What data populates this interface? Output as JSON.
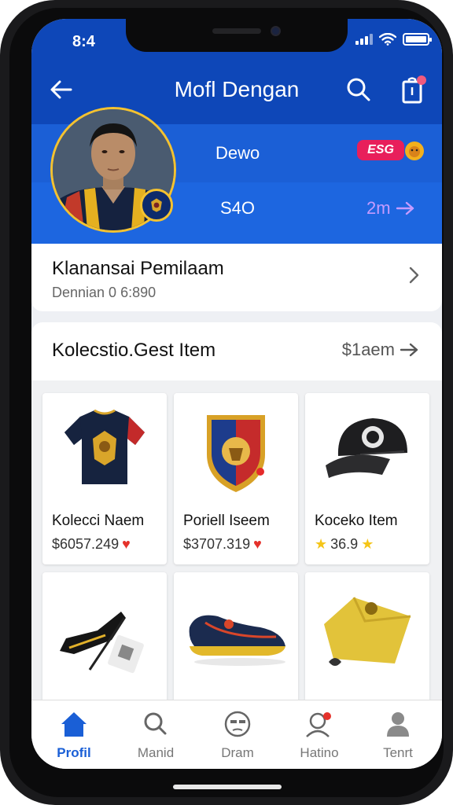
{
  "status": {
    "time": "8:4"
  },
  "header": {
    "title": "Mofl Dengan",
    "name": "Dewo",
    "brand": "ESG",
    "stat": "S4O",
    "link": "2m"
  },
  "summary": {
    "title": "Klanansai Pemilaam",
    "subtitle": "Dennian 0 6:890"
  },
  "collection": {
    "title": "Kolecstio.Gest Item",
    "link": "$1aem",
    "items": [
      {
        "name": "Kolecci Naem",
        "price": "$6057.249",
        "icon": "heart-icon",
        "thumb": "jersey"
      },
      {
        "name": "Poriell Iseem",
        "price": "$3707.319",
        "icon": "heart-icon",
        "thumb": "crest"
      },
      {
        "name": "Koceko Item",
        "price": "36.9",
        "icon": "star-icon",
        "thumb": "cap"
      },
      {
        "name": "",
        "price": "",
        "icon": "",
        "thumb": "boots"
      },
      {
        "name": "",
        "price": "",
        "icon": "",
        "thumb": "shoe"
      },
      {
        "name": "",
        "price": "",
        "icon": "",
        "thumb": "shirt"
      }
    ]
  },
  "bottom_nav": [
    {
      "label": "Profil",
      "icon": "home-icon",
      "active": true
    },
    {
      "label": "Manid",
      "icon": "search-icon",
      "active": false
    },
    {
      "label": "Dram",
      "icon": "avatar-icon",
      "active": false
    },
    {
      "label": "Hatino",
      "icon": "heart-user-icon",
      "active": false
    },
    {
      "label": "Tenrt",
      "icon": "person-icon",
      "active": false
    }
  ],
  "colors": {
    "header": "#0e47b8",
    "accent": "#1a5fd6",
    "brand": "#e81f5b",
    "link": "#c59bff"
  }
}
